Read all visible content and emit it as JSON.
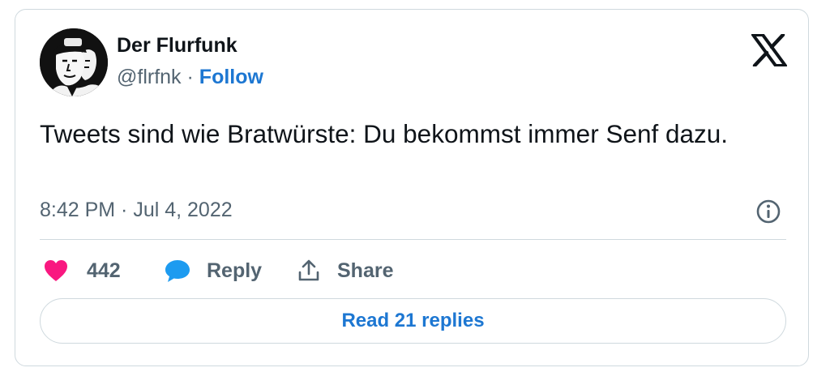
{
  "author": {
    "name": "Der Flurfunk",
    "handle": "@flrfnk",
    "separator": "·",
    "follow_label": "Follow",
    "avatar_icon": "avatar-image"
  },
  "tweet": {
    "text": "Tweets sind wie Bratwürste: Du bekommst immer Senf dazu.",
    "timestamp": "8:42 PM · Jul 4, 2022"
  },
  "actions": {
    "likes_count": "442",
    "reply_label": "Reply",
    "share_label": "Share"
  },
  "read_replies_label": "Read 21 replies",
  "icons": [
    "x-logo-icon",
    "info-icon",
    "heart-icon",
    "reply-bubble-icon",
    "share-icon"
  ],
  "colors": {
    "link_blue": "#1d77d2",
    "like_pink": "#f91880",
    "reply_blue": "#1d9bf0",
    "muted_text": "#536471",
    "border": "#cfd9de"
  }
}
